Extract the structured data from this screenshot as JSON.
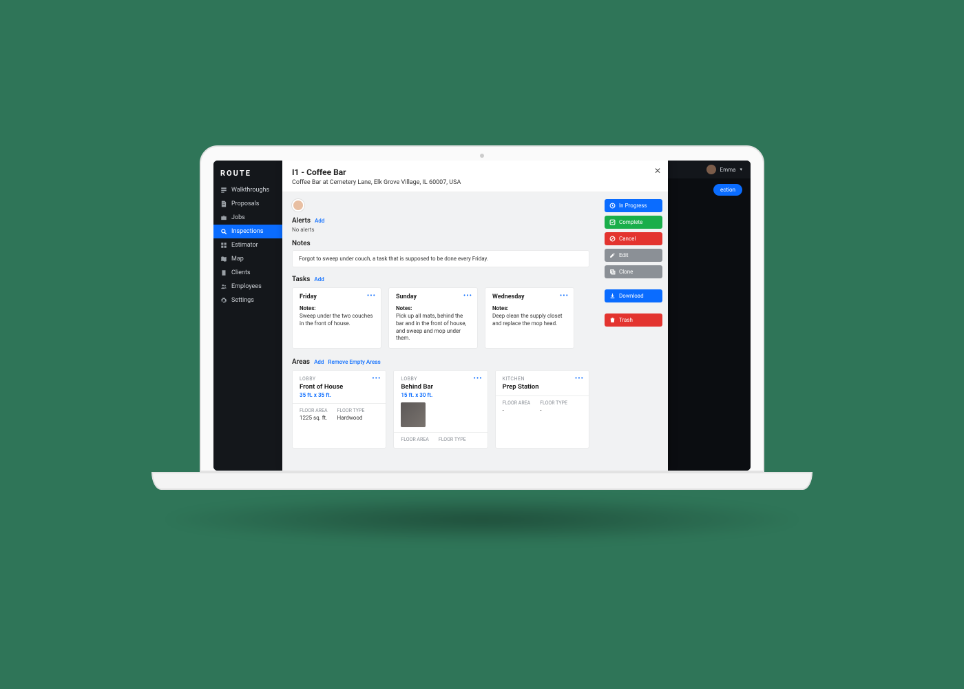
{
  "brand": "ROUTE",
  "user": {
    "name": "Emma"
  },
  "header_button": "ection",
  "sidebar": {
    "items": [
      {
        "label": "Walkthroughs"
      },
      {
        "label": "Proposals"
      },
      {
        "label": "Jobs"
      },
      {
        "label": "Inspections",
        "active": true
      },
      {
        "label": "Estimator"
      },
      {
        "label": "Map"
      },
      {
        "label": "Clients"
      },
      {
        "label": "Employees"
      },
      {
        "label": "Settings"
      }
    ]
  },
  "modal": {
    "title": "I1 - Coffee Bar",
    "address": "Coffee Bar at Cemetery Lane, Elk Grove Village, IL 60007, USA",
    "alerts": {
      "label": "Alerts",
      "add": "Add",
      "none": "No alerts"
    },
    "notes": {
      "label": "Notes",
      "text": "Forgot to sweep under couch, a task that is supposed to be done every Friday."
    },
    "tasks": {
      "label": "Tasks",
      "add": "Add",
      "items": [
        {
          "title": "Friday",
          "notes_label": "Notes:",
          "notes": "Sweep under the two couches in the front of house."
        },
        {
          "title": "Sunday",
          "notes_label": "Notes:",
          "notes": "Pick up all mats, behind the bar and in the front of house, and sweep and mop under them."
        },
        {
          "title": "Wednesday",
          "notes_label": "Notes:",
          "notes": "Deep clean the supply closet and replace the mop head."
        }
      ]
    },
    "areas": {
      "label": "Areas",
      "add": "Add",
      "remove": "Remove Empty Areas",
      "floor_area_label": "FLOOR AREA",
      "floor_type_label": "FLOOR TYPE",
      "items": [
        {
          "category": "LOBBY",
          "title": "Front of House",
          "dim": "35 ft. x 35 ft.",
          "floor_area": "1225 sq. ft.",
          "floor_type": "Hardwood"
        },
        {
          "category": "LOBBY",
          "title": "Behind Bar",
          "dim": "15 ft. x 30 ft.",
          "floor_area": "",
          "floor_type": "",
          "has_image": true
        },
        {
          "category": "KITCHEN",
          "title": "Prep Station",
          "dim": "",
          "floor_area": "-",
          "floor_type": "-"
        }
      ]
    }
  },
  "actions": {
    "in_progress": "In Progress",
    "complete": "Complete",
    "cancel": "Cancel",
    "edit": "Edit",
    "clone": "Clone",
    "download": "Download",
    "trash": "Trash"
  }
}
